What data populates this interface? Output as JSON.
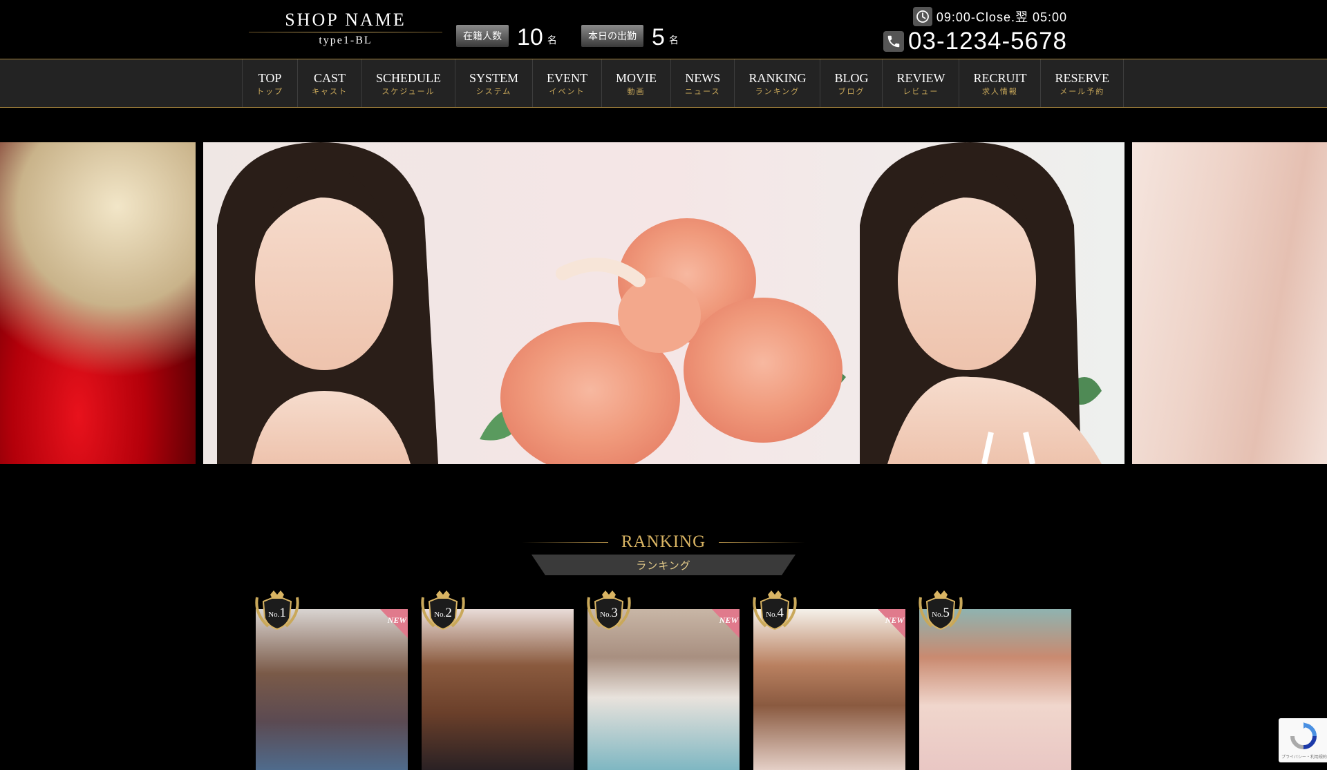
{
  "header": {
    "shop_name": "SHOP NAME",
    "shop_type": "type1-BL",
    "stats": [
      {
        "label": "在籍人数",
        "value": "10",
        "unit": "名"
      },
      {
        "label": "本日の出勤",
        "value": "5",
        "unit": "名"
      }
    ],
    "hours": "09:00-Close.翌 05:00",
    "phone": "03-1234-5678",
    "icons": {
      "hours": "clock-icon",
      "phone": "phone-icon"
    }
  },
  "nav": {
    "items": [
      {
        "en": "TOP",
        "ja": "トップ"
      },
      {
        "en": "CAST",
        "ja": "キャスト"
      },
      {
        "en": "SCHEDULE",
        "ja": "スケジュール"
      },
      {
        "en": "SYSTEM",
        "ja": "システム"
      },
      {
        "en": "EVENT",
        "ja": "イベント"
      },
      {
        "en": "MOVIE",
        "ja": "動画"
      },
      {
        "en": "NEWS",
        "ja": "ニュース"
      },
      {
        "en": "RANKING",
        "ja": "ランキング"
      },
      {
        "en": "BLOG",
        "ja": "ブログ"
      },
      {
        "en": "REVIEW",
        "ja": "レビュー"
      },
      {
        "en": "RECRUIT",
        "ja": "求人情報"
      },
      {
        "en": "RESERVE",
        "ja": "メール予約"
      }
    ]
  },
  "ranking": {
    "title_en": "RANKING",
    "title_ja": "ランキング",
    "cards": [
      {
        "rank_prefix": "No.",
        "rank": "1",
        "badge": "NEW"
      },
      {
        "rank_prefix": "No.",
        "rank": "2",
        "badge": ""
      },
      {
        "rank_prefix": "No.",
        "rank": "3",
        "badge": "NEW"
      },
      {
        "rank_prefix": "No.",
        "rank": "4",
        "badge": "NEW"
      },
      {
        "rank_prefix": "No.",
        "rank": "5",
        "badge": ""
      }
    ]
  },
  "recaptcha": {
    "text": "プライバシー・利用規約"
  },
  "colors": {
    "gold": "#c9a85a",
    "nav_bg": "#232323",
    "new_badge": "#e07a8c"
  }
}
